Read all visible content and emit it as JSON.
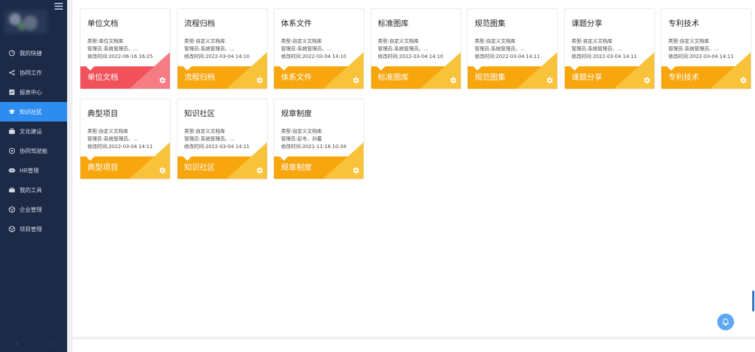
{
  "sidebar": {
    "items": [
      {
        "label": "我的快捷",
        "icon": "dashboard-icon"
      },
      {
        "label": "协同工作",
        "icon": "share-icon"
      },
      {
        "label": "报表中心",
        "icon": "chart-icon"
      },
      {
        "label": "知识社区",
        "icon": "graduation-cap-icon",
        "active": true
      },
      {
        "label": "文化建设",
        "icon": "briefcase-icon"
      },
      {
        "label": "协同驾驶舱",
        "icon": "globe-icon"
      },
      {
        "label": "HR管理",
        "icon": "hr-icon"
      },
      {
        "label": "我的工具",
        "icon": "toolbox-icon"
      },
      {
        "label": "企业管理",
        "icon": "cube-icon"
      },
      {
        "label": "项目管理",
        "icon": "cube-icon"
      }
    ],
    "footer": {
      "prev": "‹",
      "next": "›"
    }
  },
  "cards": [
    {
      "title": "单位文档",
      "type": "类型:单位文档库",
      "manager": "管理员:系统管理员、...",
      "modified": "修改时间:2022-06-16 16:25",
      "footer": "单位文档",
      "theme": "red"
    },
    {
      "title": "流程归档",
      "type": "类型:自定义文档库",
      "manager": "管理员:系统管理员、...",
      "modified": "修改时间:2022-03-04 14:10",
      "footer": "流程归档",
      "theme": "orange"
    },
    {
      "title": "体系文件",
      "type": "类型:自定义文档库",
      "manager": "管理员:系统管理员、...",
      "modified": "修改时间:2022-03-04 14:10",
      "footer": "体系文件",
      "theme": "orange"
    },
    {
      "title": "标准图库",
      "type": "类型:自定义文档库",
      "manager": "管理员:系统管理员、...",
      "modified": "修改时间:2022-03-04 14:10",
      "footer": "标准图库",
      "theme": "orange"
    },
    {
      "title": "规范图集",
      "type": "类型:自定义文档库",
      "manager": "管理员:系统管理员、...",
      "modified": "修改时间:2022-03-04 14:11",
      "footer": "规范图集",
      "theme": "orange"
    },
    {
      "title": "课题分享",
      "type": "类型:自定义文档库",
      "manager": "管理员:系统管理员、...",
      "modified": "修改时间:2022-03-04 14:11",
      "footer": "课题分享",
      "theme": "orange"
    },
    {
      "title": "专利技术",
      "type": "类型:自定义文档库",
      "manager": "管理员:系统管理员、...",
      "modified": "修改时间:2022-03-04 14:11",
      "footer": "专利技术",
      "theme": "orange"
    },
    {
      "title": "典型项目",
      "type": "类型:自定义文档库",
      "manager": "管理员:系统管理员、...",
      "modified": "修改时间:2022-03-04 14:11",
      "footer": "典型项目",
      "theme": "orange"
    },
    {
      "title": "知识社区",
      "type": "类型:自定义文档库",
      "manager": "管理员:系统管理员、...",
      "modified": "修改时间:2022-03-04 14:11",
      "footer": "知识社区",
      "theme": "orange"
    },
    {
      "title": "规章制度",
      "type": "类型:自定义文档库",
      "manager": "管理员:彭冬、孙蕾",
      "modified": "修改时间:2021-11-18 10:34",
      "footer": "规章制度",
      "theme": "orange"
    }
  ],
  "colors": {
    "sidebar_bg": "#1c2a48",
    "active_item": "#2d8cf0",
    "orange": "#f7a60e",
    "orange_light": "#f8c33a",
    "red": "#f0515a",
    "red_light": "#f57c83",
    "bell": "#5ea7f2"
  }
}
